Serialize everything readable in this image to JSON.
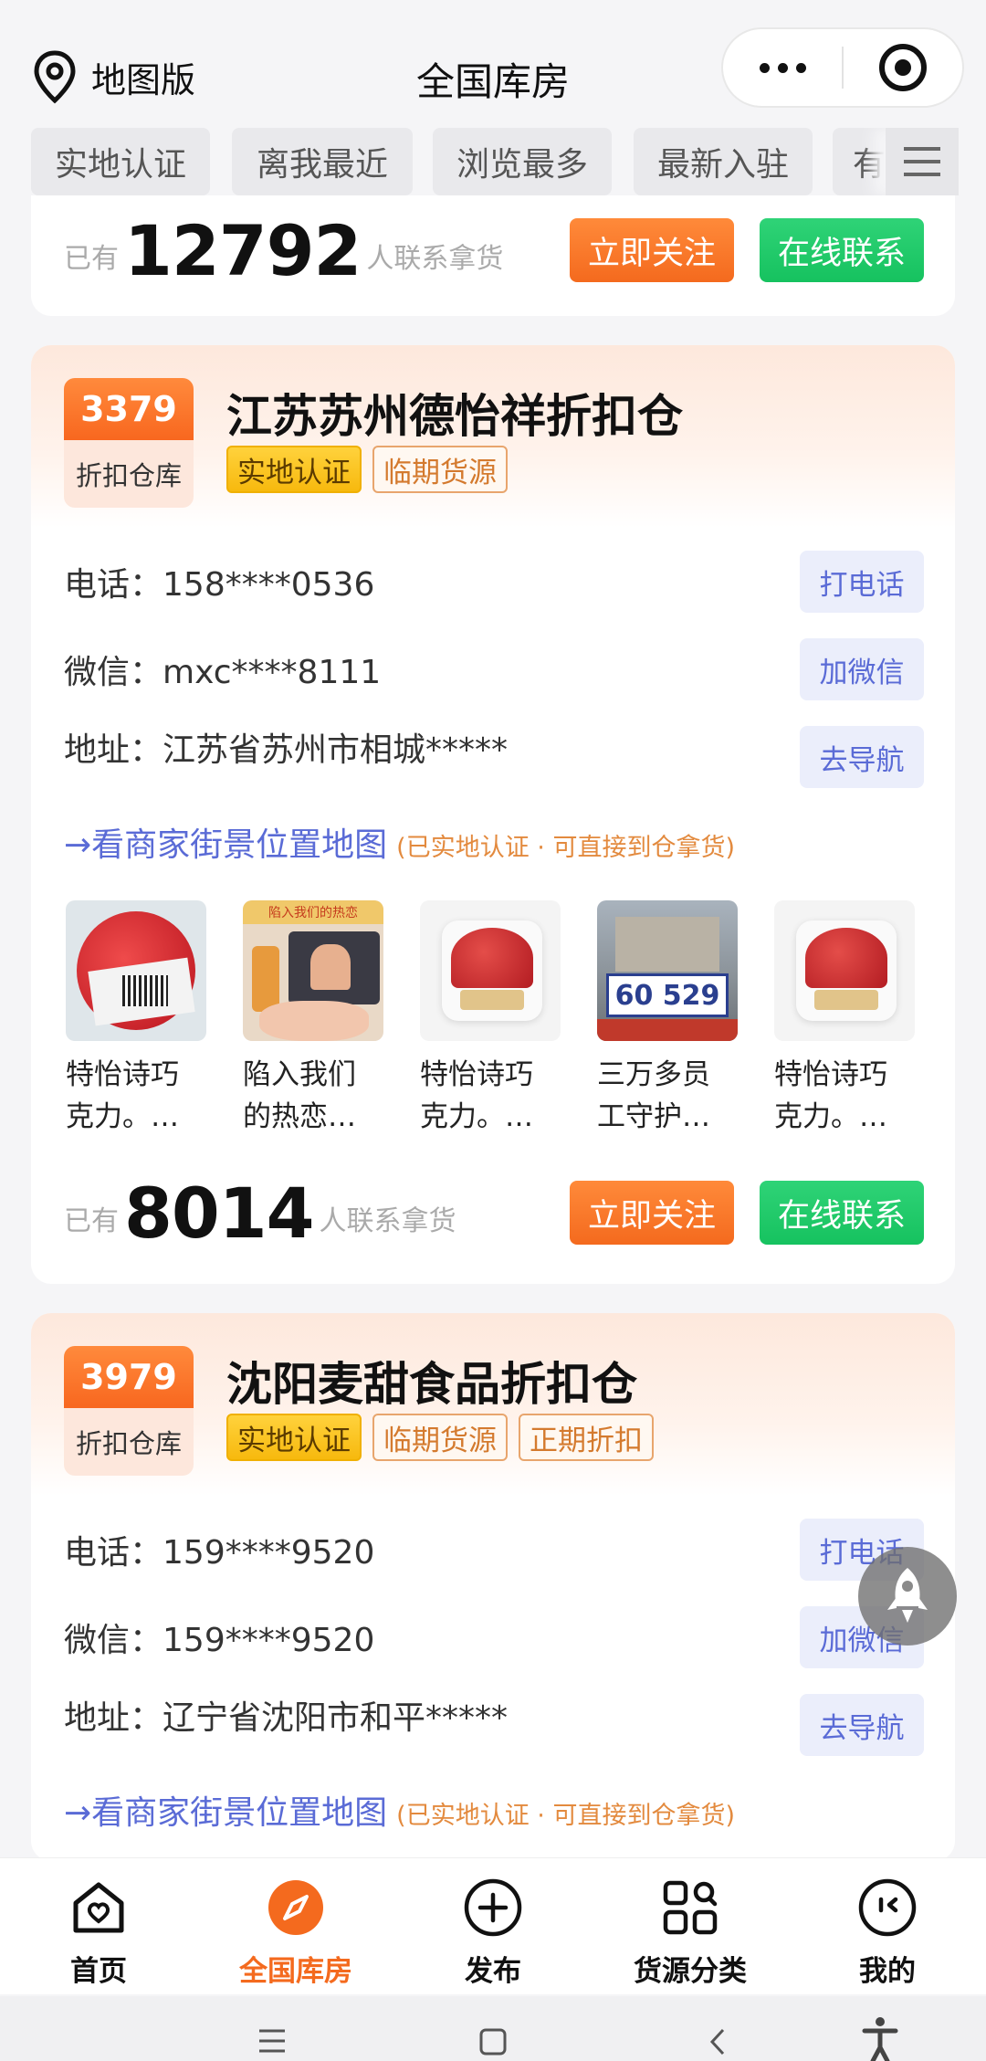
{
  "header": {
    "map_switch_label": "地图版",
    "title": "全国库房"
  },
  "filters": [
    "实地认证",
    "离我最近",
    "浏览最多",
    "最新入驻",
    "有"
  ],
  "cards": [
    {
      "contact_prefix": "已有",
      "contact_count": "12792",
      "contact_suffix": "人联系拿货",
      "follow_label": "立即关注",
      "contact_label": "在线联系"
    },
    {
      "score": "3379",
      "kind": "折扣仓库",
      "name": "江苏苏州德怡祥折扣仓",
      "tags": [
        "实地认证",
        "临期货源"
      ],
      "phone_key": "电话：",
      "phone": "158****0536",
      "phone_action": "打电话",
      "wechat_key": "微信：",
      "wechat": "mxc****8111",
      "wechat_action": "加微信",
      "address_key": "地址：",
      "address": "江苏省苏州市相城*****",
      "address_action": "去导航",
      "map_link": "→看商家街景位置地图",
      "map_note": "(已实地认证 · 可直接到仓拿货)",
      "gallery": [
        {
          "line1": "特怡诗巧",
          "line2": "克力。…"
        },
        {
          "line1": "陷入我们",
          "line2": "的热恋…",
          "badge": "陷入我们的热恋"
        },
        {
          "line1": "特怡诗巧",
          "line2": "克力。…"
        },
        {
          "line1": "三万多员",
          "line2": "工守护…",
          "banner": "60 529"
        },
        {
          "line1": "特怡诗巧",
          "line2": "克力。…"
        }
      ],
      "contact_prefix": "已有",
      "contact_count": "8014",
      "contact_suffix": "人联系拿货",
      "follow_label": "立即关注",
      "contact_label": "在线联系"
    },
    {
      "score": "3979",
      "kind": "折扣仓库",
      "name": "沈阳麦甜食品折扣仓",
      "tags": [
        "实地认证",
        "临期货源",
        "正期折扣"
      ],
      "phone_key": "电话：",
      "phone": "159****9520",
      "phone_action": "打电话",
      "wechat_key": "微信：",
      "wechat": "159****9520",
      "wechat_action": "加微信",
      "address_key": "地址：",
      "address": "辽宁省沈阳市和平*****",
      "address_action": "去导航",
      "map_link": "→看商家街景位置地图",
      "map_note": "(已实地认证 · 可直接到仓拿货)"
    }
  ],
  "tabbar": [
    {
      "label": "首页",
      "icon": "home-heart-icon"
    },
    {
      "label": "全国库房",
      "icon": "compass-icon",
      "active": true
    },
    {
      "label": "发布",
      "icon": "plus-circle-icon"
    },
    {
      "label": "货源分类",
      "icon": "grid-search-icon"
    },
    {
      "label": "我的",
      "icon": "profile-icon"
    }
  ],
  "colors": {
    "accent_orange": "#f46a1e",
    "green": "#16c25f",
    "link_blue": "#5a6bd6",
    "tag_yellow": "#f7b90e"
  }
}
